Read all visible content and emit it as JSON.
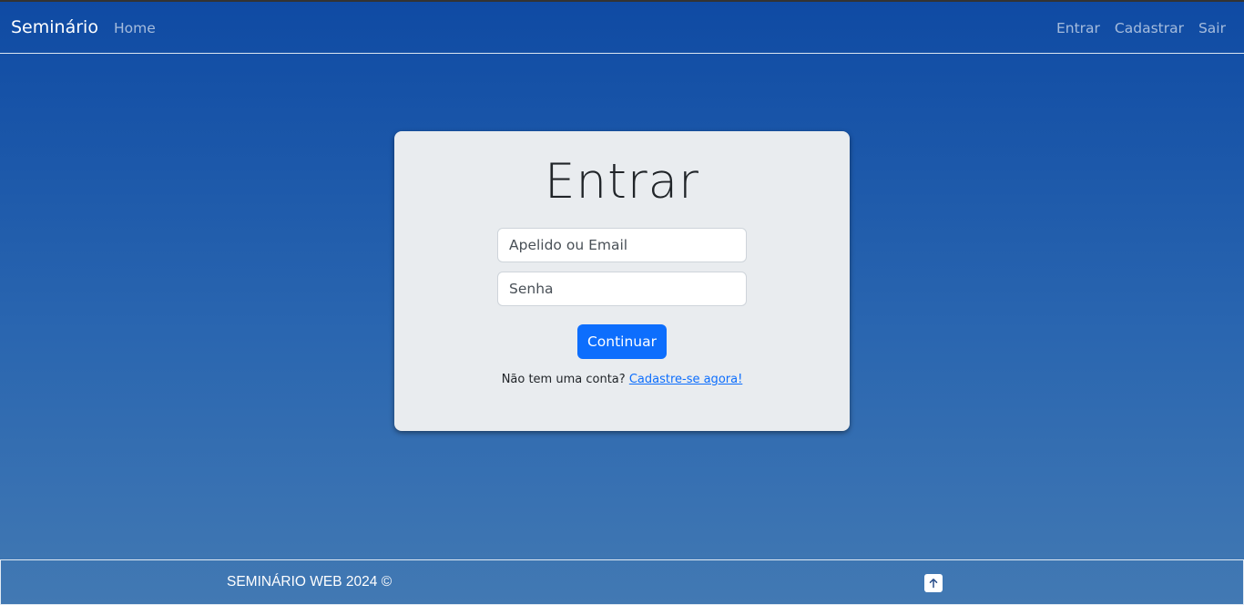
{
  "navbar": {
    "brand": "Seminário",
    "home": "Home",
    "right_links": [
      "Entrar",
      "Cadastrar",
      "Sair"
    ]
  },
  "login": {
    "title": "Entrar",
    "user_placeholder": "Apelido ou Email",
    "password_placeholder": "Senha",
    "submit_label": "Continuar",
    "signup_prompt": "Não tem uma conta?",
    "signup_link": "Cadastre-se agora!"
  },
  "footer": {
    "text": "SEMINÁRIO WEB 2024 ©",
    "to_top_icon": "arrow-up-icon"
  },
  "colors": {
    "primary_button": "#0d6efd",
    "card_background": "#e9ecef",
    "page_gradient_top": "#0f4aa3",
    "page_gradient_bottom": "#4279b3"
  }
}
